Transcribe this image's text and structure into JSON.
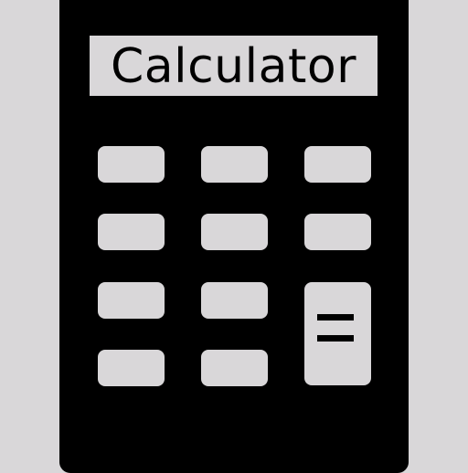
{
  "display": {
    "label": "Calculator"
  },
  "keys": {
    "equals_label": "="
  },
  "colors": {
    "background": "#d9d7d9",
    "body": "#000000",
    "key": "#d9d7d9"
  }
}
